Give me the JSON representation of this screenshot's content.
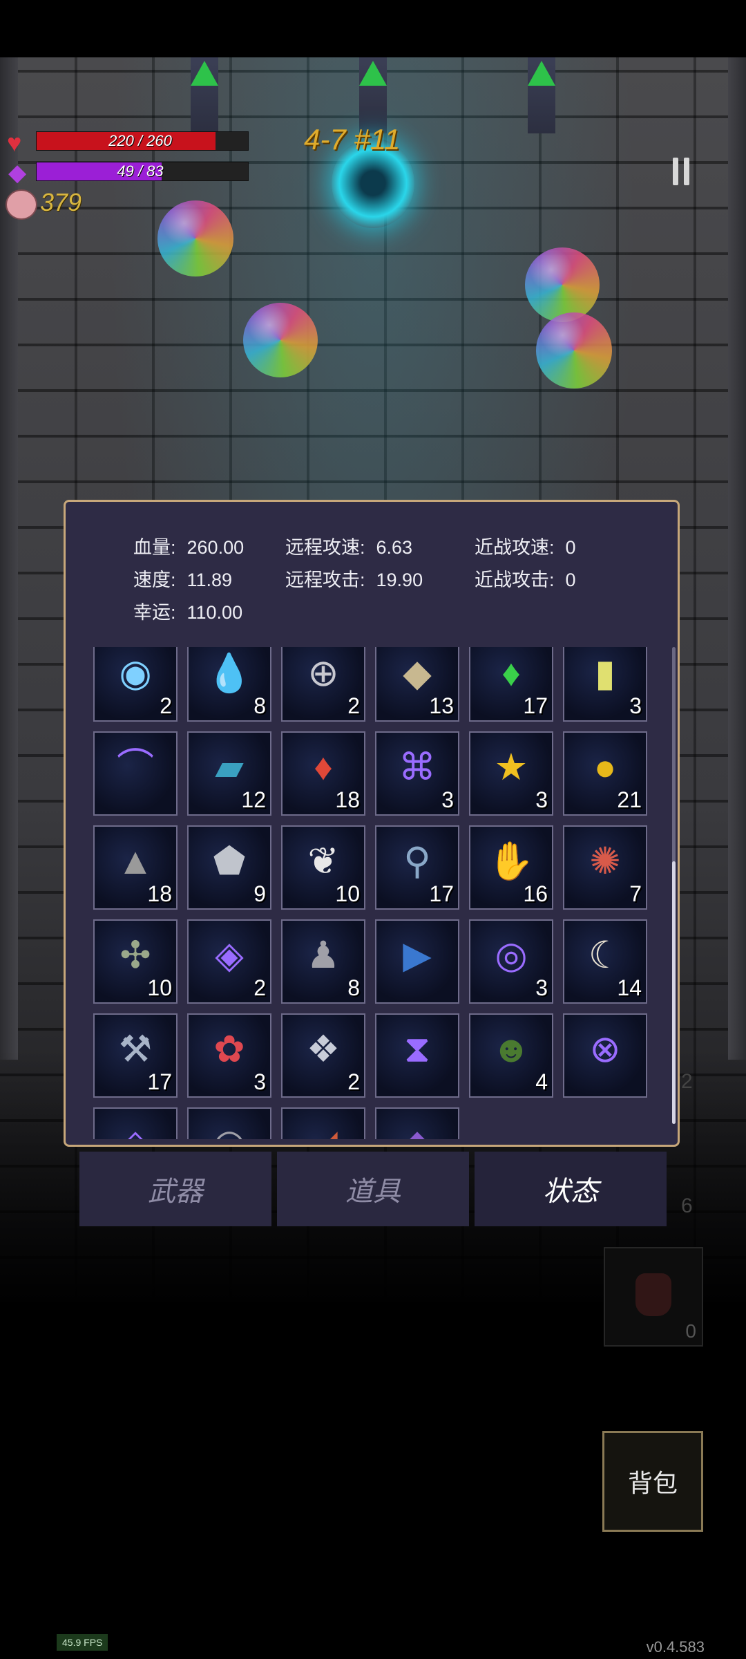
{
  "hud": {
    "hp_text": "220 / 260",
    "hp_fraction": 0.846,
    "mana_text": "49 / 83",
    "mana_fraction": 0.59,
    "gold": "379",
    "level": "4-7 #11"
  },
  "colors": {
    "hp": "#c8121c",
    "mana": "#9b1fd6",
    "gold": "#d8b640",
    "panel": "#2e2b45",
    "panel_border": "#c7a77a"
  },
  "stats": {
    "hp": {
      "label": "血量:",
      "value": "260.00"
    },
    "ranged_speed": {
      "label": "远程攻速:",
      "value": "6.63"
    },
    "melee_speed": {
      "label": "近战攻速:",
      "value": "0"
    },
    "speed": {
      "label": "速度:",
      "value": "11.89"
    },
    "ranged_attack": {
      "label": "远程攻击:",
      "value": "19.90"
    },
    "melee_attack": {
      "label": "近战攻击:",
      "value": "0"
    },
    "luck": {
      "label": "幸运:",
      "value": "110.00"
    }
  },
  "items": [
    {
      "icon": "blue-orb-icon",
      "glyph": "◉",
      "color": "#7fd0ff",
      "count": "2"
    },
    {
      "icon": "water-drop-icon",
      "glyph": "💧",
      "color": "#3c8ee0",
      "count": "8"
    },
    {
      "icon": "shield-ring-icon",
      "glyph": "⊕",
      "color": "#c8c8d0",
      "count": "2"
    },
    {
      "icon": "ore-stones-icon",
      "glyph": "◆",
      "color": "#c8b890",
      "count": "13"
    },
    {
      "icon": "green-crystal-icon",
      "glyph": "♦",
      "color": "#3ad04a",
      "count": "17"
    },
    {
      "icon": "yellow-card-icon",
      "glyph": "▮",
      "color": "#e0e070",
      "count": "3"
    },
    {
      "icon": "purple-rune-hook-icon",
      "glyph": "⌒",
      "color": "#9a6cff",
      "count": ""
    },
    {
      "icon": "blue-book-icon",
      "glyph": "▰",
      "color": "#3aa0c0",
      "count": "12"
    },
    {
      "icon": "red-crystal-icon",
      "glyph": "♦",
      "color": "#e04838",
      "count": "18"
    },
    {
      "icon": "purple-rune-eye-icon",
      "glyph": "⌘",
      "color": "#9a6cff",
      "count": "3"
    },
    {
      "icon": "star-trophy-icon",
      "glyph": "★",
      "color": "#f0c020",
      "count": "3"
    },
    {
      "icon": "gold-coin-icon",
      "glyph": "●",
      "color": "#e6b81a",
      "count": "21"
    },
    {
      "icon": "tombstone-icon",
      "glyph": "▲",
      "color": "#9a9a9a",
      "count": "18"
    },
    {
      "icon": "silver-ore-icon",
      "glyph": "⬟",
      "color": "#c0c4cc",
      "count": "9"
    },
    {
      "icon": "feather-icon",
      "glyph": "❦",
      "color": "#e8e8e8",
      "count": "10"
    },
    {
      "icon": "potion-vial-icon",
      "glyph": "⚲",
      "color": "#8aa8c8",
      "count": "17"
    },
    {
      "icon": "red-gloves-icon",
      "glyph": "✋",
      "color": "#a84a3a",
      "count": "16"
    },
    {
      "icon": "feathered-skull-icon",
      "glyph": "✺",
      "color": "#d85a4a",
      "count": "7"
    },
    {
      "icon": "tentacle-creature-icon",
      "glyph": "✣",
      "color": "#9aa88a",
      "count": "10"
    },
    {
      "icon": "purple-rune-arrows-icon",
      "glyph": "◈",
      "color": "#9a6cff",
      "count": "2"
    },
    {
      "icon": "hooded-figure-icon",
      "glyph": "♟",
      "color": "#a0a0a8",
      "count": "8"
    },
    {
      "icon": "spellbook-icon",
      "glyph": "▶",
      "color": "#3a78d0",
      "count": ""
    },
    {
      "icon": "purple-rune-spiral-icon",
      "glyph": "◎",
      "color": "#9a6cff",
      "count": "3"
    },
    {
      "icon": "horn-icon",
      "glyph": "☾",
      "color": "#e8e0d0",
      "count": "14"
    },
    {
      "icon": "hammer-icon",
      "glyph": "⚒",
      "color": "#a8b4c8",
      "count": "17"
    },
    {
      "icon": "red-flower-icon",
      "glyph": "✿",
      "color": "#e04850",
      "count": "3"
    },
    {
      "icon": "silver-diamond-icon",
      "glyph": "❖",
      "color": "#c8ccd8",
      "count": "2"
    },
    {
      "icon": "purple-rune-hourglass-icon",
      "glyph": "⧗",
      "color": "#9a6cff",
      "count": ""
    },
    {
      "icon": "green-tome-icon",
      "glyph": "☻",
      "color": "#4a7a30",
      "count": "4"
    },
    {
      "icon": "purple-rune-cross-icon",
      "glyph": "⊗",
      "color": "#9a6cff",
      "count": ""
    },
    {
      "icon": "purple-rune-partial-icon",
      "glyph": "◇",
      "color": "#9a6cff",
      "count": ""
    },
    {
      "icon": "gray-item-partial-icon",
      "glyph": "◠",
      "color": "#a0a0a8",
      "count": ""
    },
    {
      "icon": "red-item-partial-icon",
      "glyph": "◢",
      "color": "#d05a3a",
      "count": ""
    },
    {
      "icon": "purple-item-partial-icon",
      "glyph": "◆",
      "color": "#8a5ad0",
      "count": ""
    }
  ],
  "tabs": [
    "武器",
    "道具",
    "状态"
  ],
  "side_counts": {
    "left_a": "2",
    "left_b": "6",
    "potion": "0"
  },
  "bag_label": "背包",
  "fps": "45.9 FPS",
  "version": "v0.4.583"
}
